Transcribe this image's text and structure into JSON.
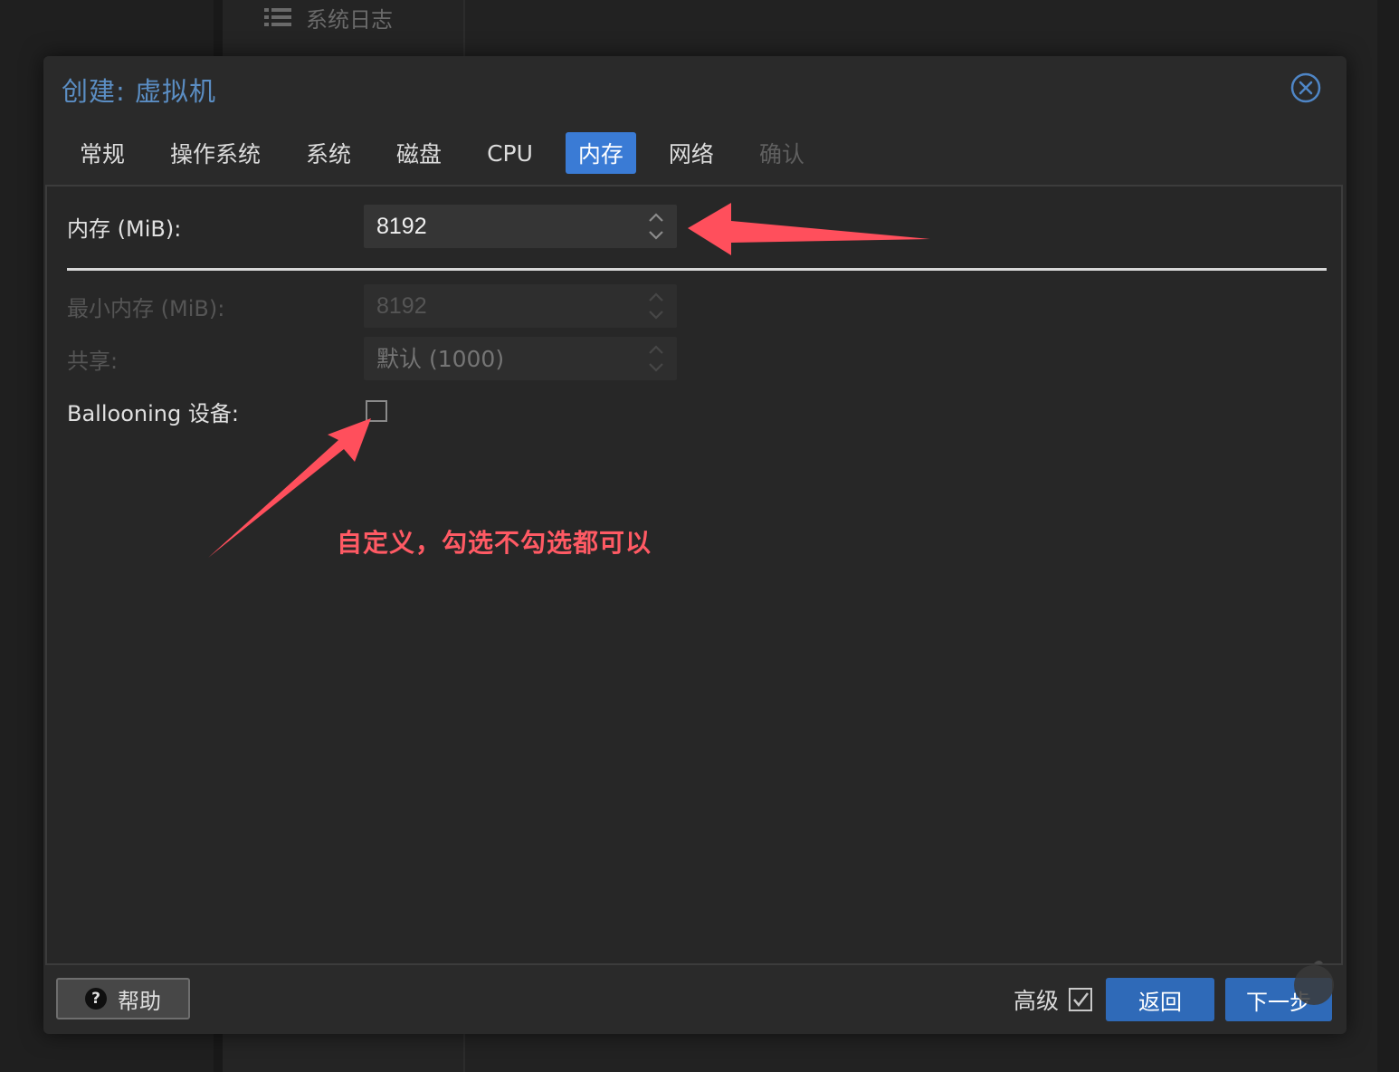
{
  "background": {
    "nav_item_label": "系统日志"
  },
  "dialog": {
    "title": "创建: 虚拟机",
    "tabs": [
      {
        "label": "常规",
        "state": "normal"
      },
      {
        "label": "操作系统",
        "state": "normal"
      },
      {
        "label": "系统",
        "state": "normal"
      },
      {
        "label": "磁盘",
        "state": "normal"
      },
      {
        "label": "CPU",
        "state": "normal"
      },
      {
        "label": "内存",
        "state": "active"
      },
      {
        "label": "网络",
        "state": "normal"
      },
      {
        "label": "确认",
        "state": "disabled"
      }
    ],
    "memory": {
      "label": "内存 (MiB):",
      "value": "8192"
    },
    "min_memory": {
      "label": "最小内存 (MiB):",
      "value": "8192"
    },
    "shares": {
      "label": "共享:",
      "placeholder": "默认 (1000)"
    },
    "ballooning": {
      "label": "Ballooning 设备:",
      "checked": false
    },
    "annotation": "自定义，勾选不勾选都可以",
    "footer": {
      "help_label": "帮助",
      "advanced_label": "高级",
      "advanced_checked": true,
      "back_label": "返回",
      "next_label": "下一步"
    }
  },
  "colors": {
    "accent": "#3a7bd5",
    "button_primary": "#2f6ab8",
    "title": "#5b8ec4",
    "annotation": "#ff5a64"
  }
}
